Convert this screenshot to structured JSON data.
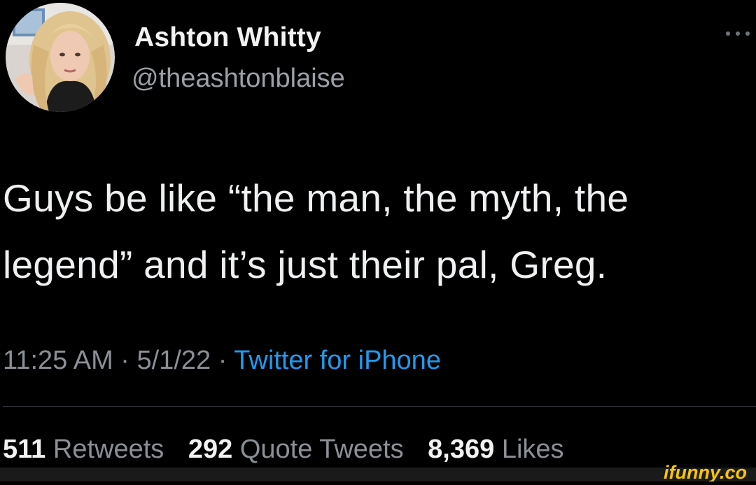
{
  "author": {
    "display_name": "Ashton Whitty",
    "handle": "@theashtonblaise",
    "avatar_icon": "profile-photo"
  },
  "tweet": {
    "text_lines": [
      "Guys be like “the man, the myth, the",
      "legend” and it’s just their pal, Greg."
    ],
    "time": "11:25 AM",
    "separator": "·",
    "date": "5/1/22",
    "source": "Twitter for iPhone"
  },
  "stats": {
    "retweets_count": "511",
    "retweets_label": "Retweets",
    "quote_tweets_count": "292",
    "quote_tweets_label": "Quote Tweets",
    "likes_count": "8,369",
    "likes_label": "Likes"
  },
  "watermark": {
    "text": "ifunny.co",
    "color": "#f7c600"
  },
  "colors": {
    "background": "#000000",
    "text": "#eef0f1",
    "muted": "#8b9096",
    "link": "#1d9bf0"
  }
}
